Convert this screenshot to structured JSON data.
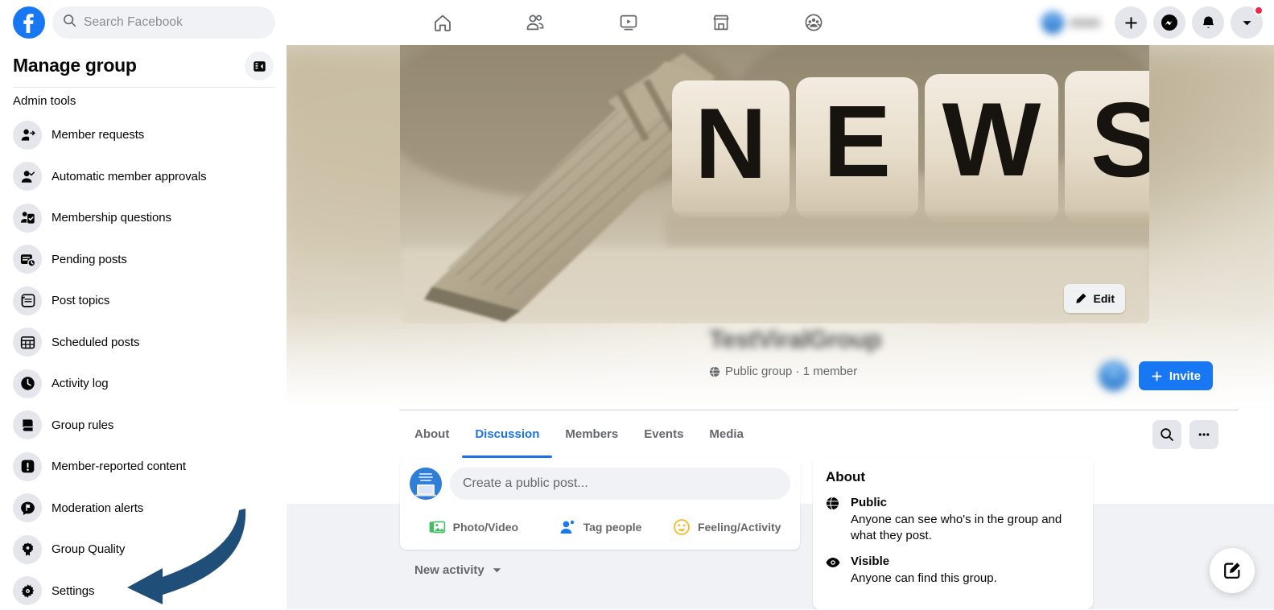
{
  "header": {
    "logo_icon": "facebook-logo-icon",
    "search": {
      "placeholder": "Search Facebook",
      "icon": "search-icon"
    },
    "nav_tabs": [
      {
        "name": "home",
        "icon": "home-icon",
        "active": false
      },
      {
        "name": "friends",
        "icon": "friends-icon",
        "active": false
      },
      {
        "name": "watch",
        "icon": "video-icon",
        "active": false
      },
      {
        "name": "marketplace",
        "icon": "marketplace-icon",
        "active": false
      },
      {
        "name": "groups",
        "icon": "groups-icon",
        "active": true
      }
    ],
    "right_actions": [
      {
        "name": "profile",
        "icon": "avatar-icon",
        "label": ""
      },
      {
        "name": "create",
        "icon": "plus-icon"
      },
      {
        "name": "messenger",
        "icon": "messenger-icon"
      },
      {
        "name": "notifications",
        "icon": "bell-icon"
      },
      {
        "name": "account",
        "icon": "chevron-down-icon",
        "has_badge": true
      }
    ]
  },
  "sidebar": {
    "title": "Manage group",
    "subtitle": "Admin tools",
    "collapse_icon": "sidebar-collapse-icon",
    "items": [
      {
        "label": "Member requests",
        "icon": "member-request-icon"
      },
      {
        "label": "Automatic member approvals",
        "icon": "member-approve-icon"
      },
      {
        "label": "Membership questions",
        "icon": "membership-questions-icon"
      },
      {
        "label": "Pending posts",
        "icon": "pending-posts-icon"
      },
      {
        "label": "Post topics",
        "icon": "post-topics-icon"
      },
      {
        "label": "Scheduled posts",
        "icon": "calendar-icon"
      },
      {
        "label": "Activity log",
        "icon": "clock-icon"
      },
      {
        "label": "Group rules",
        "icon": "book-icon"
      },
      {
        "label": "Member-reported content",
        "icon": "exclamation-icon"
      },
      {
        "label": "Moderation alerts",
        "icon": "flag-comment-icon"
      },
      {
        "label": "Group Quality",
        "icon": "badge-icon"
      },
      {
        "label": "Settings",
        "icon": "gear-icon"
      }
    ]
  },
  "annotation": {
    "type": "curved-arrow",
    "points_to": "Settings",
    "color": "#1F4E79"
  },
  "cover": {
    "description": "Rolled newspapers beside wooden dice spelling NEWS",
    "dice_letters": [
      "N",
      "E",
      "W",
      "S"
    ],
    "edit_button": {
      "label": "Edit",
      "icon": "pencil-icon"
    }
  },
  "group": {
    "name": "TestViralGroup",
    "name_blurred": true,
    "privacy_icon": "globe-icon",
    "meta": "Public group · 1 member",
    "invite_button": {
      "label": "Invite",
      "icon": "plus-icon"
    },
    "member_avatar": "member-avatar"
  },
  "tabs": {
    "items": [
      {
        "label": "About",
        "active": false
      },
      {
        "label": "Discussion",
        "active": true
      },
      {
        "label": "Members",
        "active": false
      },
      {
        "label": "Events",
        "active": false
      },
      {
        "label": "Media",
        "active": false
      }
    ],
    "actions": [
      {
        "name": "search",
        "icon": "search-icon"
      },
      {
        "name": "more",
        "icon": "ellipsis-icon"
      }
    ]
  },
  "composer": {
    "avatar": "group-avatar",
    "placeholder": "Create a public post...",
    "actions": [
      {
        "label": "Photo/Video",
        "icon": "photo-video-icon",
        "color": "#45BD62"
      },
      {
        "label": "Tag people",
        "icon": "tag-people-icon",
        "color": "#1877F2"
      },
      {
        "label": "Feeling/Activity",
        "icon": "feeling-icon",
        "color": "#F7B928"
      }
    ]
  },
  "feed": {
    "sort_label": "New activity",
    "sort_icon": "caret-down-icon"
  },
  "about_panel": {
    "title": "About",
    "rows": [
      {
        "icon": "globe-icon",
        "heading": "Public",
        "body": "Anyone can see who's in the group and what they post."
      },
      {
        "icon": "eye-icon",
        "heading": "Visible",
        "body": "Anyone can find this group."
      }
    ]
  },
  "fab": {
    "name": "compose-fab",
    "icon": "compose-icon"
  },
  "colors": {
    "brand_blue": "#1877F2",
    "active_tab": "#1B74E4",
    "page_bg": "#F0F2F5",
    "badge_red": "#F02849",
    "annotation_blue": "#1F4E79"
  }
}
